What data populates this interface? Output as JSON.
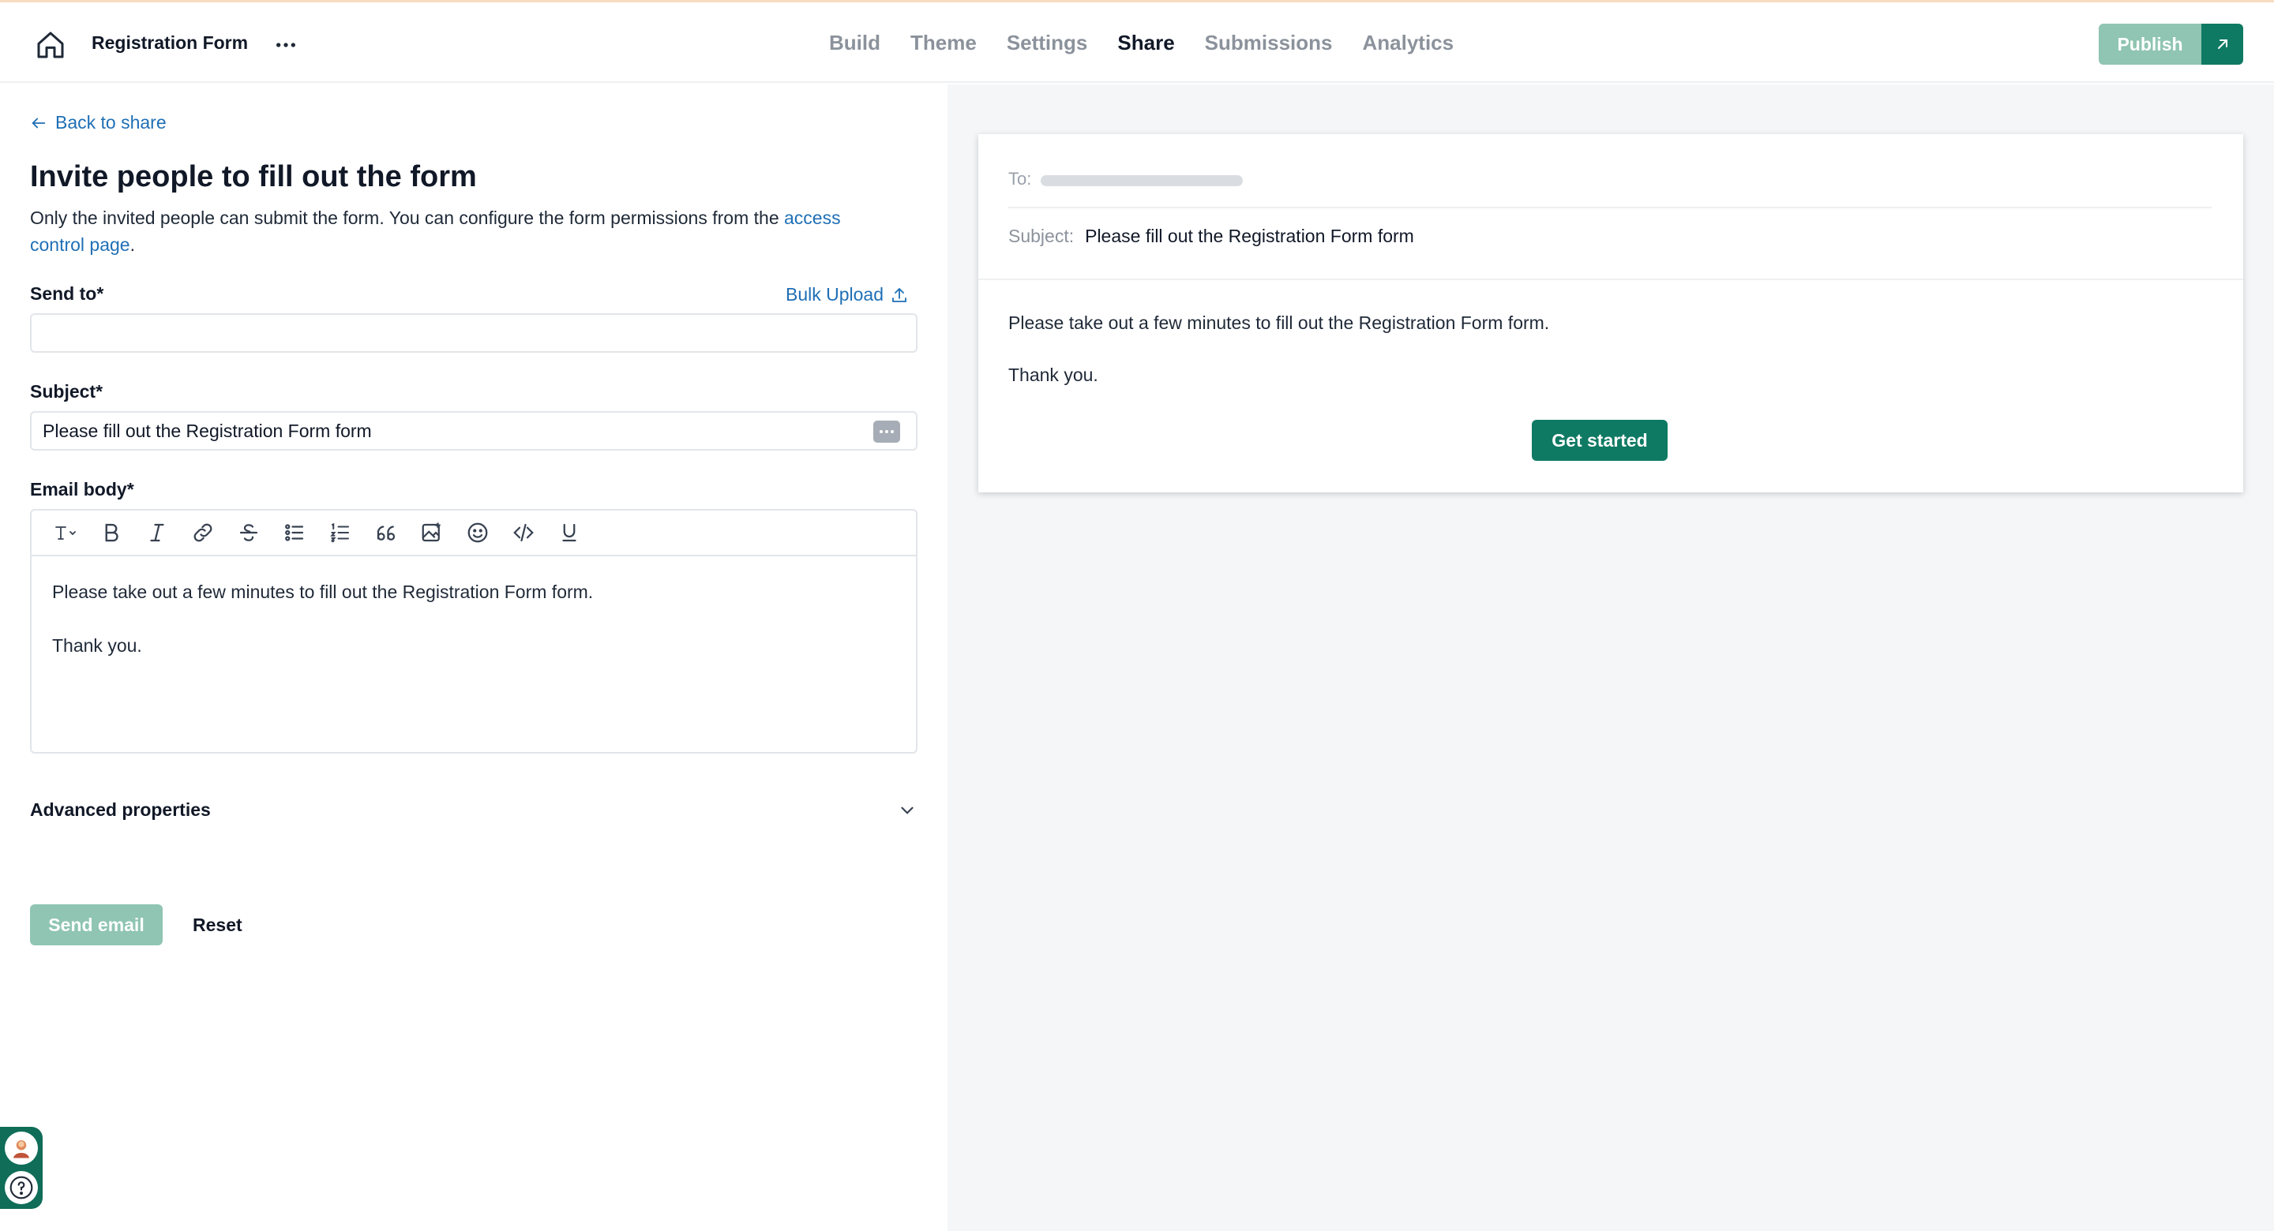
{
  "header": {
    "form_title": "Registration Form",
    "nav": [
      {
        "label": "Build",
        "active": false
      },
      {
        "label": "Theme",
        "active": false
      },
      {
        "label": "Settings",
        "active": false
      },
      {
        "label": "Share",
        "active": true
      },
      {
        "label": "Submissions",
        "active": false
      },
      {
        "label": "Analytics",
        "active": false
      }
    ],
    "publish_label": "Publish"
  },
  "left": {
    "back_label": "Back to share",
    "title": "Invite people to fill out the form",
    "description": "Only the invited people can submit the form. You can configure the form permissions from the ",
    "description_link": "access control page",
    "description_end": ".",
    "send_to_label": "Send to*",
    "bulk_upload_label": "Bulk Upload",
    "send_to_value": "",
    "subject_label": "Subject*",
    "subject_value": "Please fill out the Registration Form form",
    "email_body_label": "Email body*",
    "email_body": {
      "line1": "Please take out a few minutes to fill out the Registration Form form.",
      "line2": "Thank you."
    },
    "advanced_label": "Advanced properties",
    "send_email_label": "Send email",
    "reset_label": "Reset"
  },
  "preview": {
    "to_label": "To:",
    "subject_label": "Subject:",
    "subject_value": "Please fill out the Registration Form form",
    "body_line1": "Please take out a few minutes to fill out the Registration Form form.",
    "body_line2": "Thank you.",
    "cta_label": "Get started"
  },
  "colors": {
    "accent": "#0f7a63",
    "accent_disabled": "#8fc5b2",
    "link": "#1f6fb5"
  }
}
